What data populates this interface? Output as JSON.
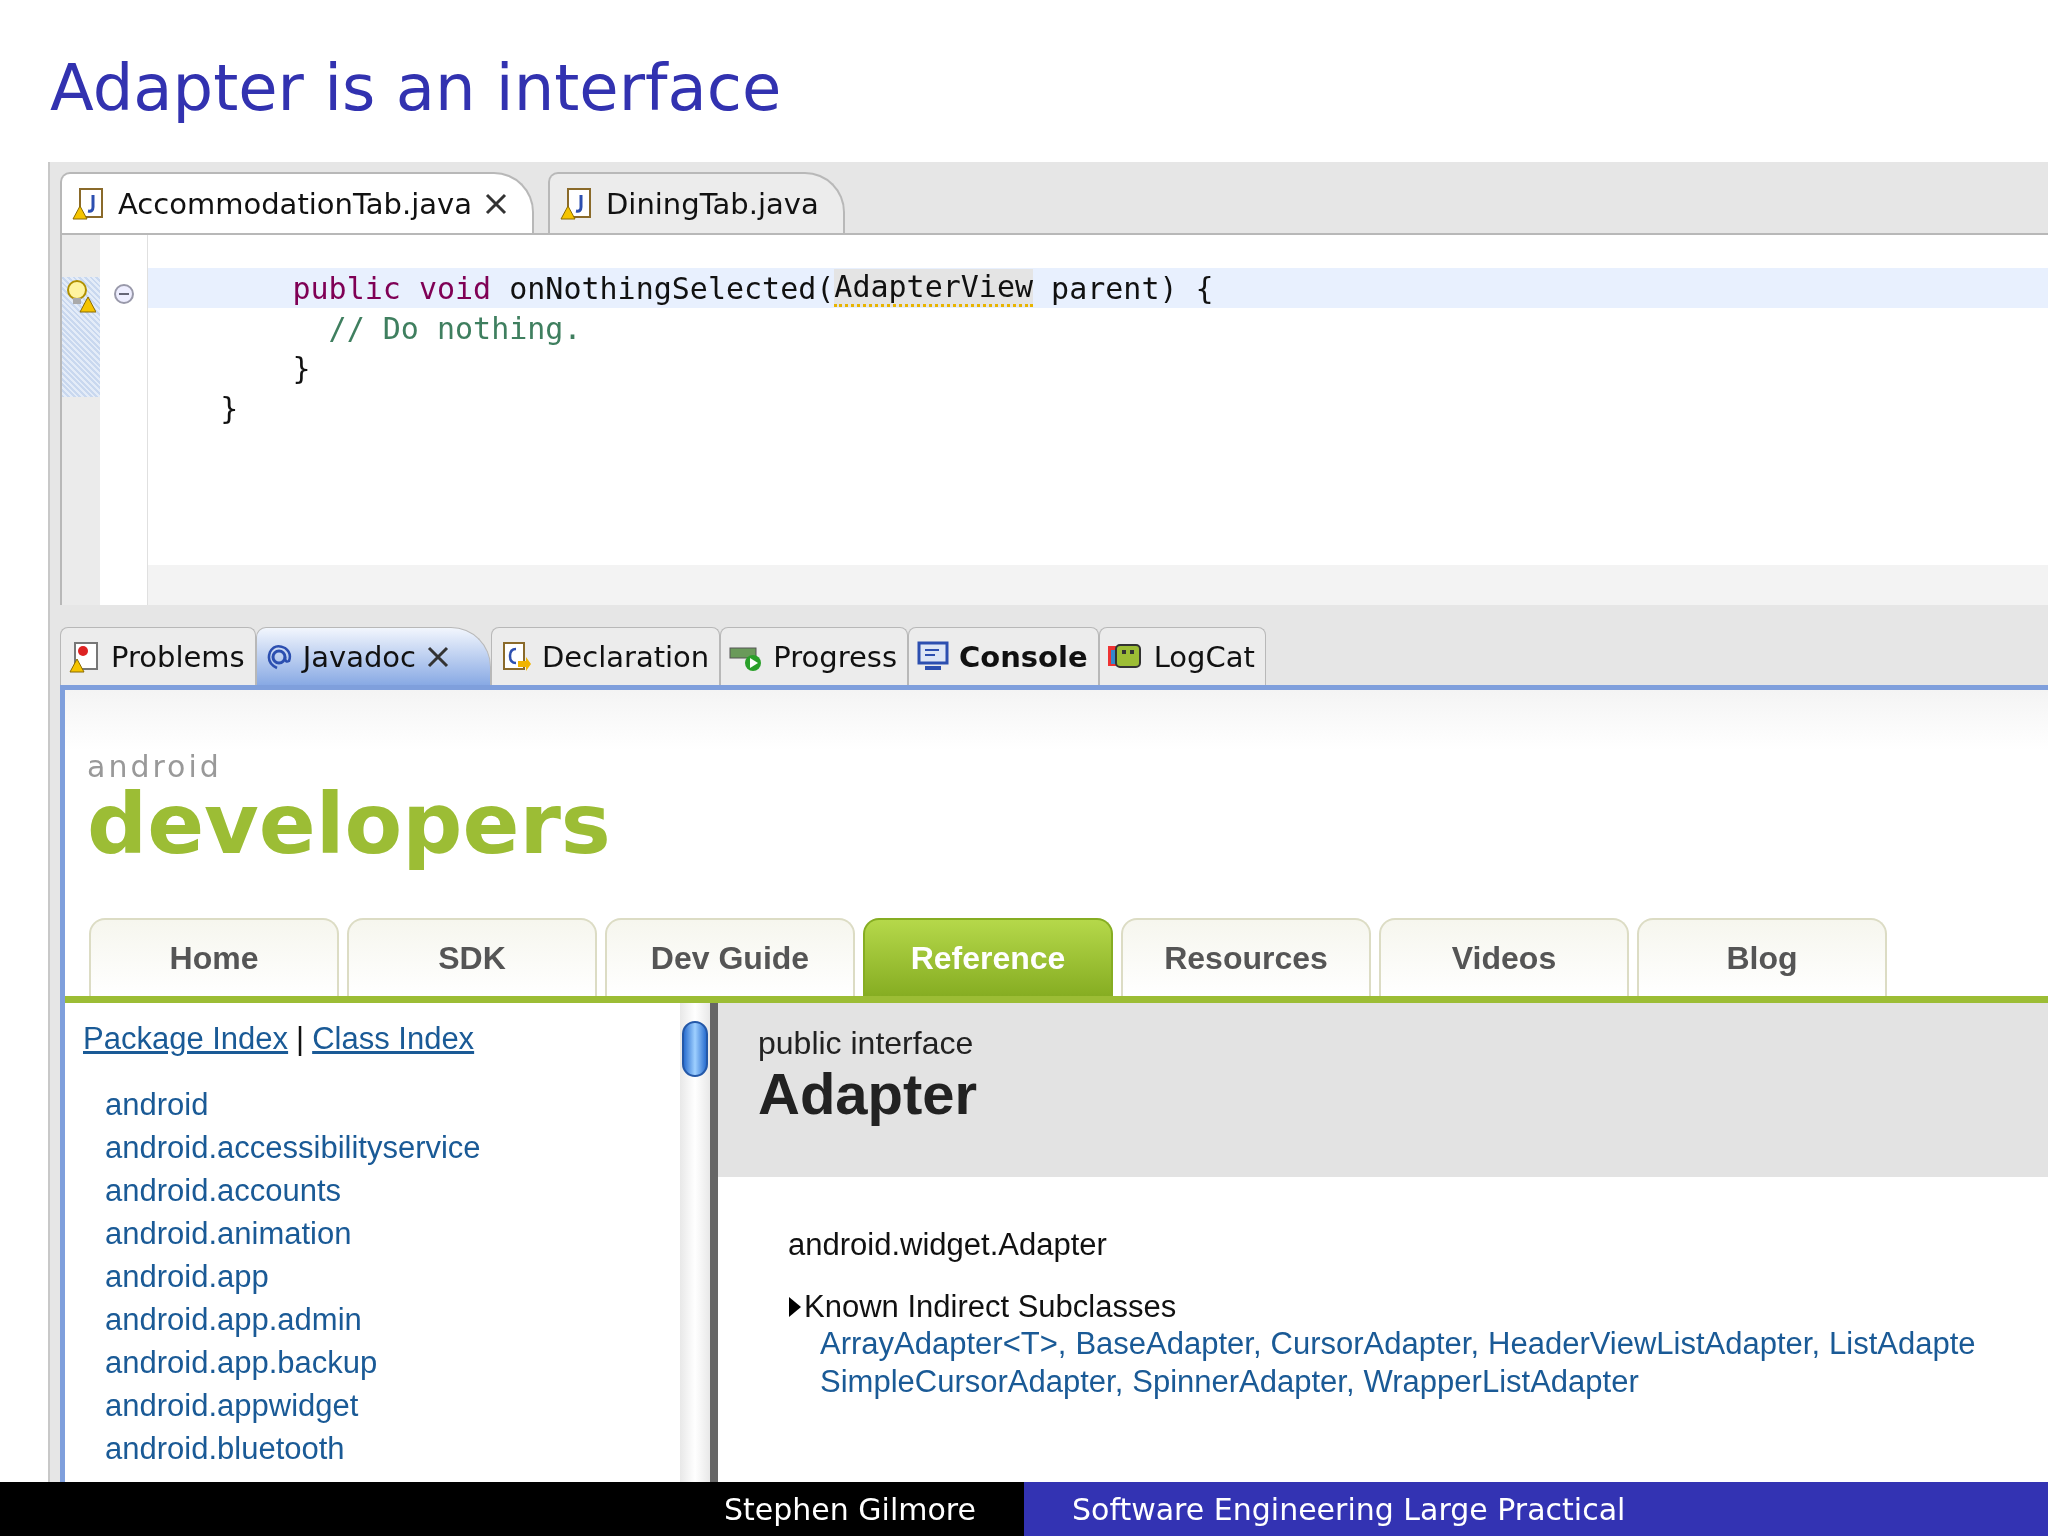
{
  "slide_title": "Adapter is an interface",
  "editor_tabs": [
    {
      "label": "AccommodationTab.java",
      "selected": true
    },
    {
      "label": "DiningTab.java",
      "selected": false
    }
  ],
  "code_lines": [
    {
      "current": true,
      "segments": [
        {
          "text": "        public void",
          "kind": "keyword"
        },
        {
          "text": " onNothingSelected(",
          "kind": "plain"
        },
        {
          "text": "AdapterView",
          "kind": "highlight"
        },
        {
          "text": " parent) {",
          "kind": "plain"
        }
      ]
    },
    {
      "current": false,
      "segments": [
        {
          "text": "          // Do nothing.",
          "kind": "comment"
        }
      ]
    },
    {
      "current": false,
      "segments": [
        {
          "text": "        }",
          "kind": "plain"
        }
      ]
    },
    {
      "current": false,
      "segments": [
        {
          "text": "    }",
          "kind": "plain"
        }
      ]
    }
  ],
  "view_tabs": [
    {
      "label": "Problems",
      "selected": false,
      "bold": false
    },
    {
      "label": "Javadoc",
      "selected": true,
      "bold": false
    },
    {
      "label": "Declaration",
      "selected": false,
      "bold": false
    },
    {
      "label": "Progress",
      "selected": false,
      "bold": false
    },
    {
      "label": "Console",
      "selected": false,
      "bold": true
    },
    {
      "label": "LogCat",
      "selected": false,
      "bold": false
    }
  ],
  "javadoc": {
    "logo_small": "android",
    "logo_large": "developers",
    "nav_tabs": [
      {
        "label": "Home",
        "selected": false
      },
      {
        "label": "SDK",
        "selected": false
      },
      {
        "label": "Dev Guide",
        "selected": false
      },
      {
        "label": "Reference",
        "selected": true
      },
      {
        "label": "Resources",
        "selected": false
      },
      {
        "label": "Videos",
        "selected": false
      },
      {
        "label": "Blog",
        "selected": false
      }
    ],
    "index_links": [
      "Package Index",
      "Class Index"
    ],
    "index_separator": "|",
    "packages": [
      "android",
      "android.accessibilityservice",
      "android.accounts",
      "android.animation",
      "android.app",
      "android.app.admin",
      "android.app.backup",
      "android.appwidget",
      "android.bluetooth"
    ],
    "class_kind": "public interface",
    "class_name": "Adapter",
    "qualified_name": "android.widget.Adapter",
    "subclasses_heading": "Known Indirect Subclasses",
    "subclass_lines": [
      [
        "ArrayAdapter<T>,",
        "BaseAdapter,",
        "CursorAdapter,",
        "HeaderViewListAdapter,",
        "ListAdapte"
      ],
      [
        "SimpleCursorAdapter,",
        "SpinnerAdapter,",
        "WrapperListAdapter"
      ]
    ]
  },
  "footer": {
    "author": "Stephen Gilmore",
    "course": "Software Engineering Large Practical"
  }
}
